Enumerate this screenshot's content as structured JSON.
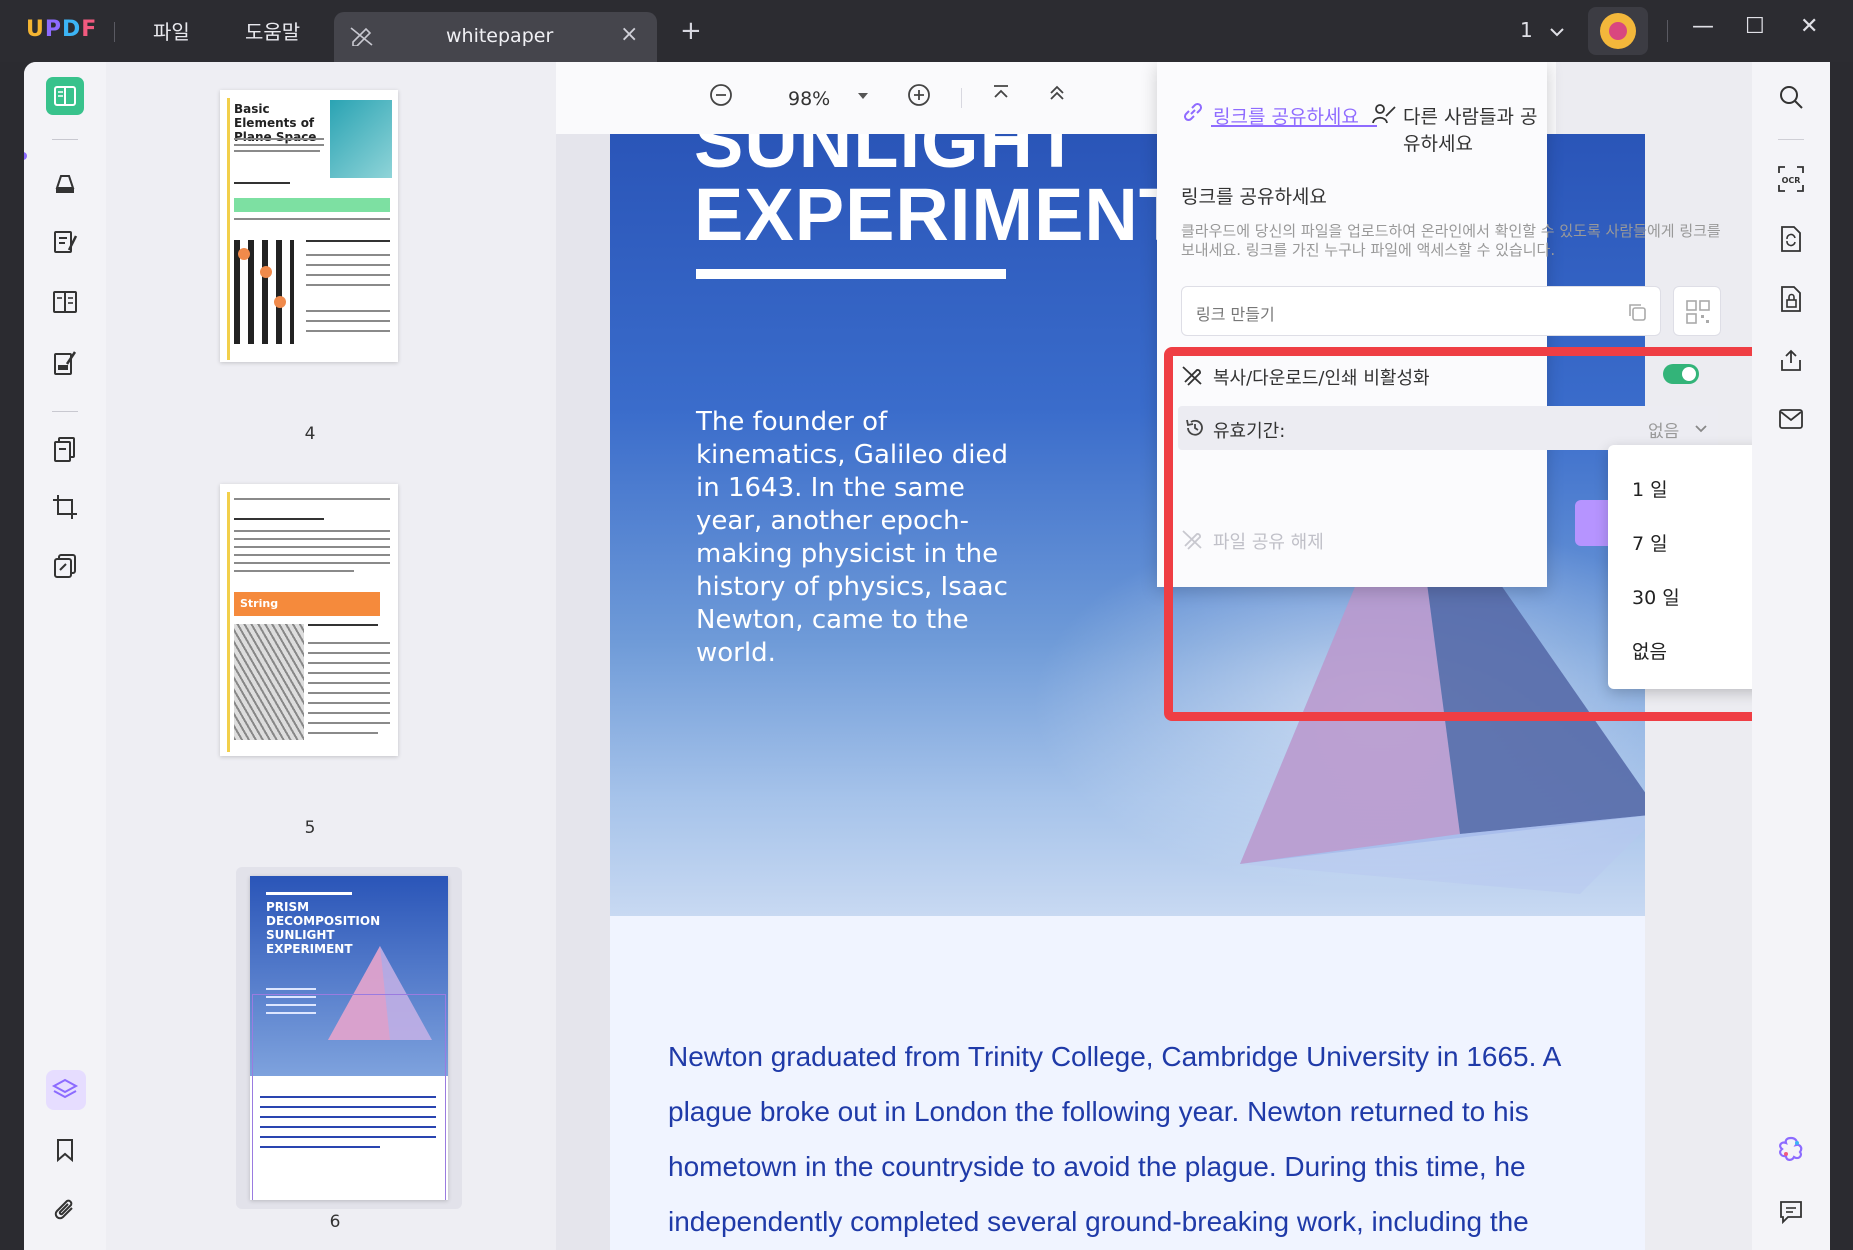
{
  "titlebar": {
    "logo": {
      "u": "U",
      "p": "P",
      "d": "D",
      "f": "F"
    },
    "menu": [
      "파일",
      "도움말"
    ],
    "tab_title": "whitepaper",
    "tab_close": "×",
    "new_tab": "+",
    "page_selector": "1",
    "window_buttons": {
      "minimize": "—",
      "maximize": "☐",
      "close": "✕"
    }
  },
  "thumbnails": [
    {
      "page": "4",
      "title": "Basic Elements of\nPlane Space"
    },
    {
      "page": "5",
      "tag": "String"
    },
    {
      "page": "6",
      "title": "PRISM\nDECOMPOSITION\nSUNLIGHT\nEXPERIMENT"
    }
  ],
  "zoombar": {
    "zoom_level": "98%"
  },
  "document": {
    "heading_line1": "SUNLIGHT",
    "heading_line2": "EXPERIMENT",
    "hero_paragraph": "The founder of kinematics, Galileo died in 1643. In the same year, another epoch-making physicist in the history of physics, Isaac Newton, came to the world.",
    "body_paragraph": "Newton graduated from Trinity College, Cambridge University in 1665. A plague broke out in London the following year. Newton returned to his hometown in the countryside to avoid the plague. During this time, he independently completed several ground-breaking work, including the"
  },
  "share_panel": {
    "tab_link": "링크를 공유하세요",
    "tab_people": "다른 사람들과 공유하세요",
    "heading": "링크를 공유하세요",
    "description": "클라우드에 당신의 파일을 업로드하여 온라인에서 확인할 수 있도록 사람들에게 링크를 보내세요. 링크를 가진 누구나 파일에 액세스할 수 있습니다.",
    "link_placeholder": "링크 만들기",
    "disable_copy_label": "복사/다운로드/인쇄 비활성화",
    "disable_copy_enabled": true,
    "expiry_label": "유효기간:",
    "expiry_value": "없음",
    "unshare_label": "파일 공유 해제"
  },
  "expiry_dropdown": {
    "options": [
      "1 일",
      "7 일",
      "30 일",
      "없음"
    ]
  },
  "colors": {
    "accent": "#8f6bff",
    "highlight_box": "#ef3e44",
    "toggle_on": "#33b479",
    "active_tool": "#38c28c"
  }
}
